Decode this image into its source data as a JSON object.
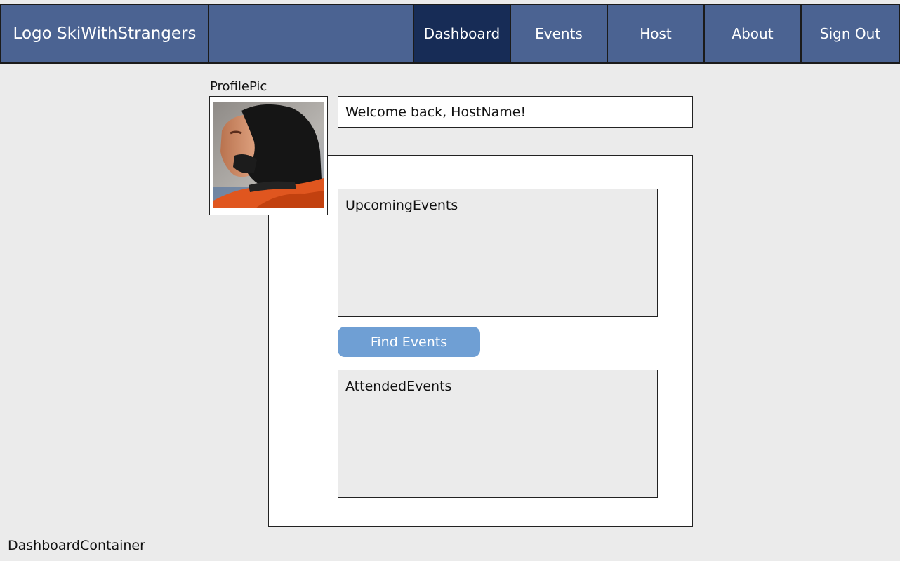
{
  "navbar": {
    "logo_text": "Logo SkiWithStrangers",
    "links": [
      {
        "label": "Dashboard",
        "active": true
      },
      {
        "label": "Events",
        "active": false
      },
      {
        "label": "Host",
        "active": false
      },
      {
        "label": "About",
        "active": false
      },
      {
        "label": "Sign Out",
        "active": false
      }
    ]
  },
  "profile": {
    "label": "ProfilePic"
  },
  "welcome": {
    "text": "Welcome back, HostName!"
  },
  "upcoming": {
    "title": "UpcomingEvents"
  },
  "find_button": {
    "label": "Find Events"
  },
  "attended": {
    "title": "AttendedEvents"
  },
  "footer": {
    "container_label": "DashboardContainer"
  },
  "colors": {
    "nav_bg": "#4b6392",
    "nav_active": "#172c56",
    "button": "#6f9fd4",
    "page_bg": "#ebebeb"
  }
}
